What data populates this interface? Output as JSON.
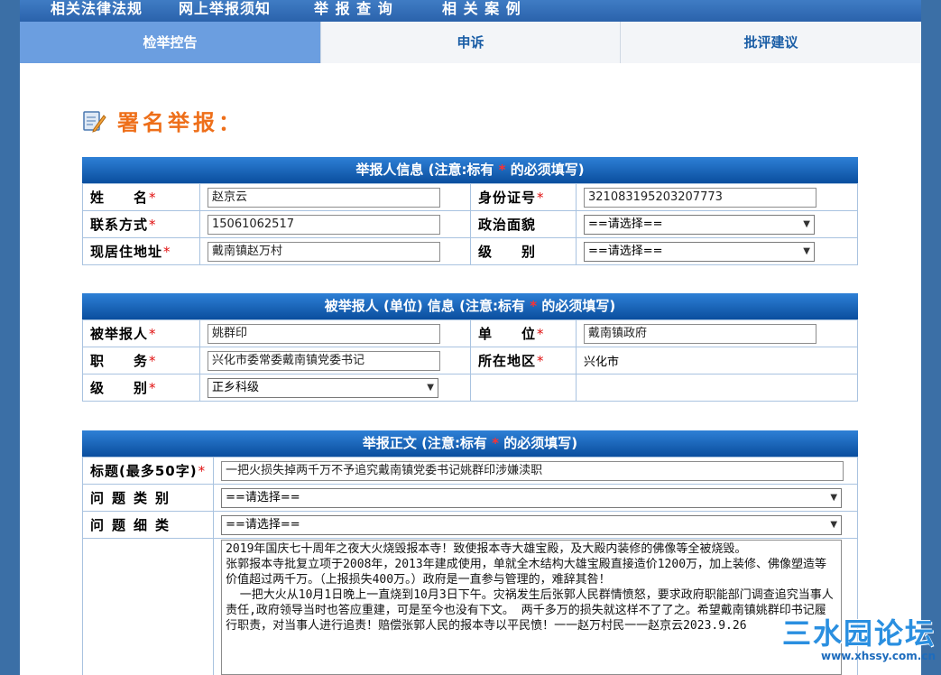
{
  "topnav": [
    "相关法律法规",
    "网上举报须知",
    "举 报 查 询",
    "相 关 案 例"
  ],
  "tabs": [
    {
      "label": "检举控告",
      "active": true
    },
    {
      "label": "申诉",
      "active": false
    },
    {
      "label": "批评建议",
      "active": false
    }
  ],
  "heading": "署名举报：",
  "reporter": {
    "title_pre": "举报人信息 (注意:标有 ",
    "title_star": "*",
    "title_post": " 的必须填写)",
    "name_label": "姓　　名",
    "name_value": "赵京云",
    "id_label": "身份证号",
    "id_value": "321083195203207773",
    "phone_label": "联系方式",
    "phone_value": "15061062517",
    "politics_label": "政治面貌",
    "politics_value": "==请选择==",
    "address_label": "现居住地址",
    "address_value": "戴南镇赵万村",
    "level_label": "级　　别",
    "level_value": "==请选择=="
  },
  "accused": {
    "title_pre": "被举报人 (单位) 信息 (注意:标有 ",
    "title_star": "*",
    "title_post": " 的必须填写)",
    "name_label": "被举报人",
    "name_value": "姚群印",
    "unit_label": "单　　位",
    "unit_value": "戴南镇政府",
    "duty_label": "职　　务",
    "duty_value": "兴化市委常委戴南镇党委书记",
    "region_label": "所在地区",
    "region_value": "兴化市",
    "level_label": "级　　别",
    "level_value": "正乡科级"
  },
  "content": {
    "title_pre": "举报正文 (注意:标有 ",
    "title_star": "*",
    "title_post": " 的必须填写)",
    "subject_label": "标题(最多50字)",
    "subject_value": "一把火损失掉两千万不予追究戴南镇党委书记姚群印涉嫌渎职",
    "category_label": "问题类别",
    "category_value": "==请选择==",
    "detail_label": "问题细类",
    "detail_value": "==请选择==",
    "body_text": "2019年国庆七十周年之夜大火烧毁报本寺！致使报本寺大雄宝殿，及大殿内装修的佛像等全被烧毁。\n张郭报本寺批复立项于2008年，2013年建成使用，单就全木结构大雄宝殿直接造价1200万，加上装修、佛像塑造等价值超过两千万。（上报损失400万。）政府是一直参与管理的，难辞其咎！\n  一把大火从10月1日晚上一直烧到10月3日下午。灾祸发生后张郭人民群情愤怒，要求政府职能部门调查追究当事人责任,政府领导当时也答应重建，可是至今也没有下文。 两千多万的损失就这样不了了之。希望戴南镇姚群印书记履行职责，对当事人进行追责！赔偿张郭人民的报本寺以平民愤！一一赵万村民一一赵京云2023.9.26"
  },
  "watermark": {
    "title": "三水园论坛",
    "url": "www.xhssy.com.cn"
  },
  "colors": {
    "accent": "#0a4e9e",
    "heading": "#ee6f1a",
    "required": "#e01010"
  }
}
